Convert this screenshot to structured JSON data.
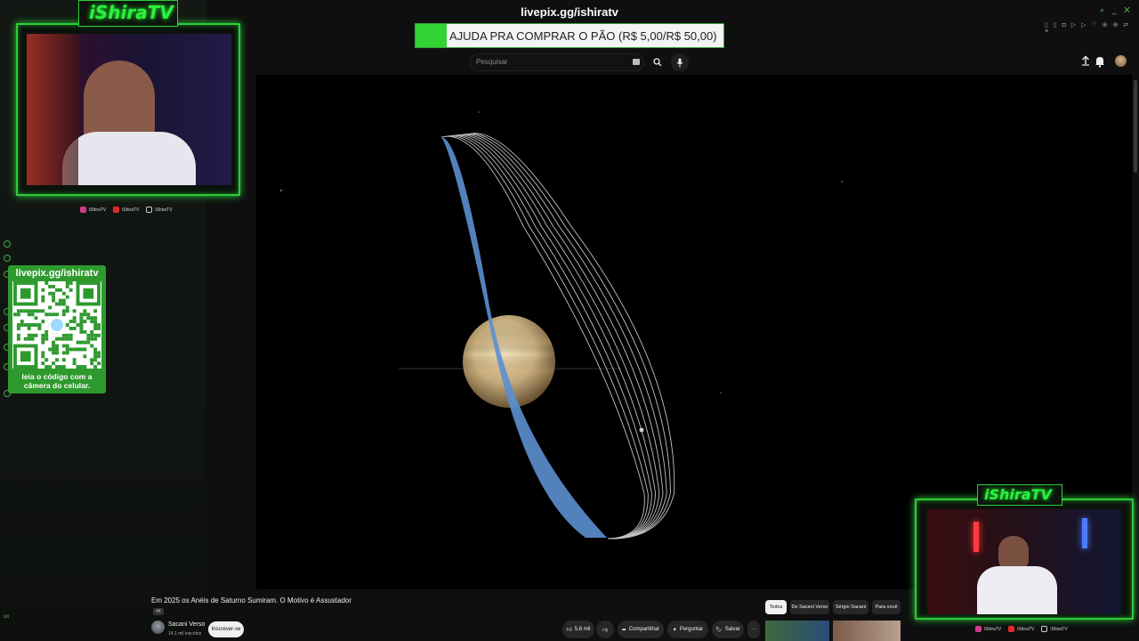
{
  "overlay": {
    "livepix_url": "livepix.gg/ishiratv",
    "donation_text": "AJUDA PRA COMPRAR O PÃO (R$ 5,00/R$ 50,00)",
    "donation_progress": 0.1,
    "accent_color": "#2ccd3a",
    "qr_url": "livepix.gg/ishiratv",
    "qr_caption_line1": "leia o código com a",
    "qr_caption_line2": "câmera do celular."
  },
  "webcam_main": {
    "title": "iShiraTV",
    "socials": [
      {
        "icon": "instagram-icon",
        "label": "iShiraTV"
      },
      {
        "icon": "youtube-icon",
        "label": "iShiraTV"
      },
      {
        "icon": "tiktok-icon",
        "label": "iShiraTV"
      }
    ]
  },
  "webcam_small": {
    "title": "iShiraTV",
    "socials": [
      {
        "icon": "instagram-icon",
        "label": "iShiraTV"
      },
      {
        "icon": "youtube-icon",
        "label": "iShiraTV"
      },
      {
        "icon": "tiktok-icon",
        "label": "iShiraTV"
      }
    ]
  },
  "youtube": {
    "search_placeholder": "Pesquisar",
    "video_title": "Em 2025 os Anéis de Saturno Sumiram. O Motivo é Assustador",
    "quality_badge": "4K",
    "channel_name": "Sacani Verso",
    "subscriber_count": "14,1 mil inscritos",
    "subscribe_label": "Inscrever-se",
    "like_count": "5,6 mil",
    "share_label": "Compartilhar",
    "ask_label": "Perguntar",
    "save_label": "Salvar",
    "more_label": "···",
    "chips": [
      "Todos",
      "De Sacani Verso",
      "Sérgio Sacani",
      "Para você"
    ]
  },
  "left_rail": {
    "bottom_label": "ox"
  }
}
